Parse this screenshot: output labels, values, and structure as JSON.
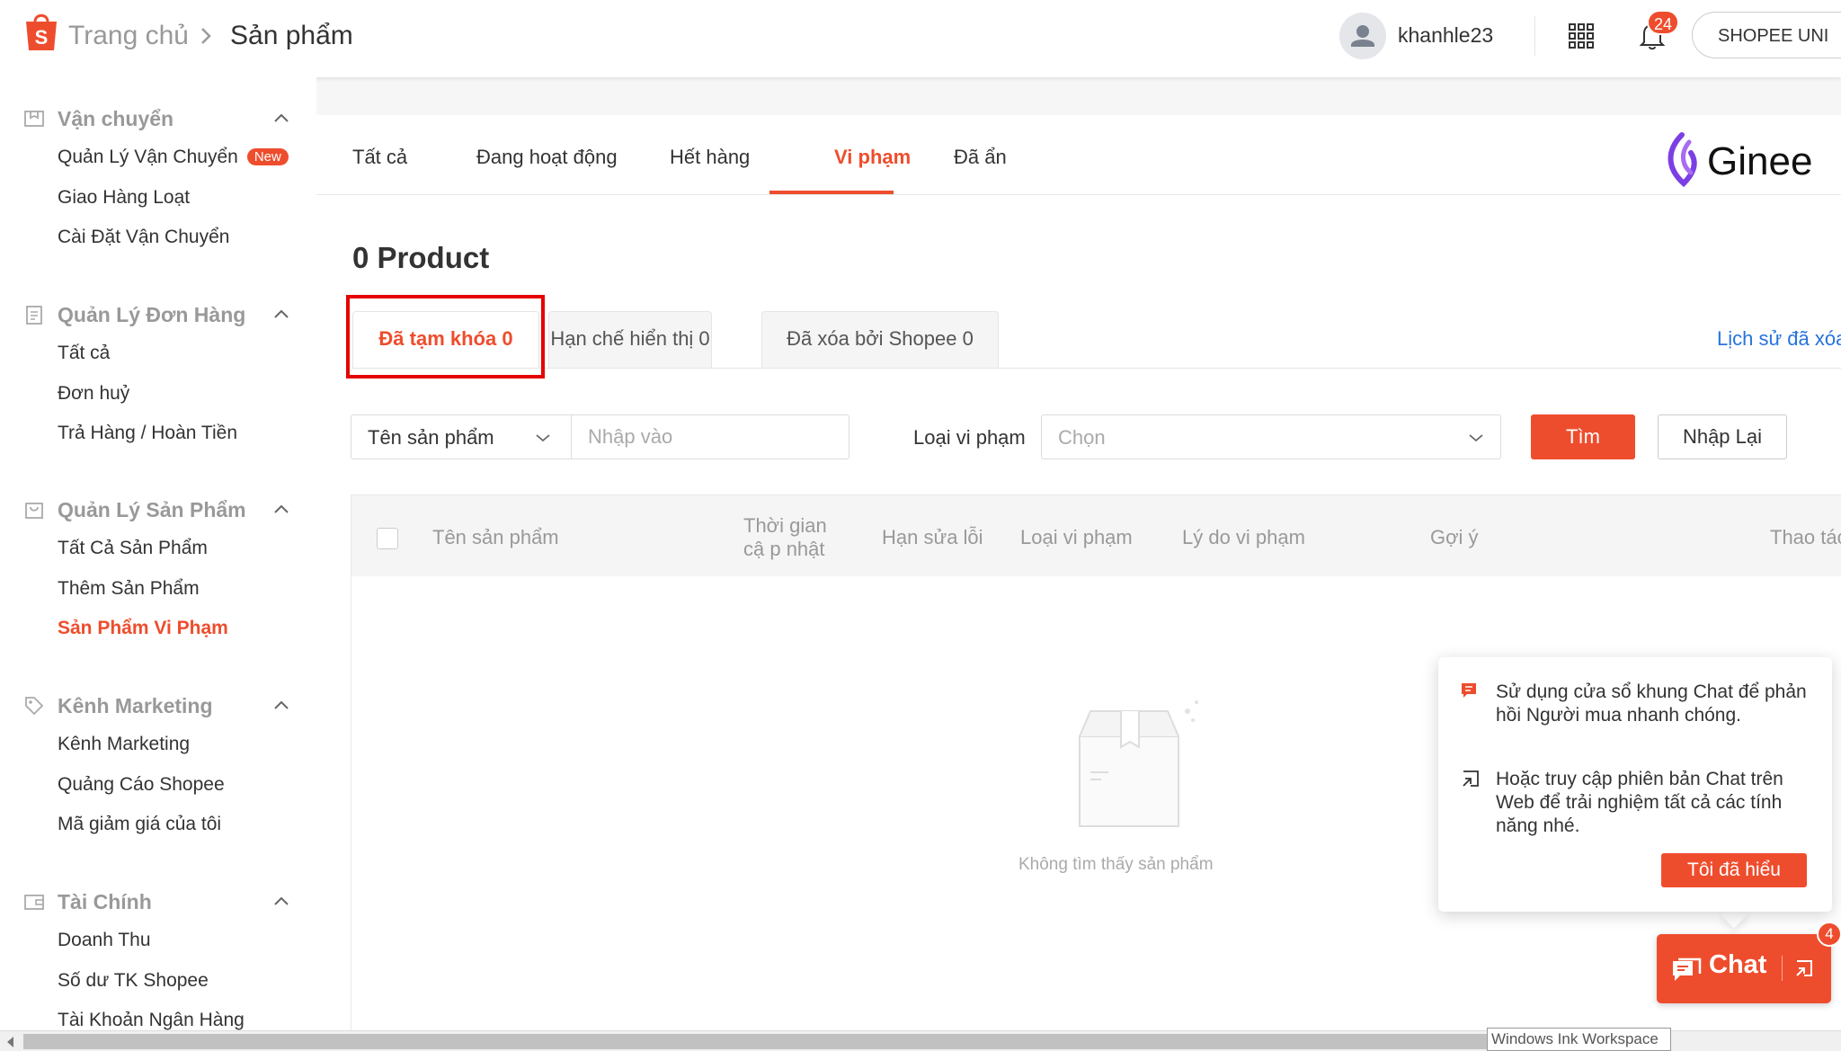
{
  "header": {
    "breadcrumb_home": "Trang chủ",
    "breadcrumb_current": "Sản phẩm",
    "username": "khanhle23",
    "notification_count": "24",
    "shop_button": "SHOPEE UNI"
  },
  "sidebar": {
    "sections": [
      {
        "title": "Vận chuyển",
        "icon": "shipping-box-icon",
        "items": [
          "Quản Lý Vận Chuyển",
          "Giao Hàng Loạt",
          "Cài Đặt Vận Chuyển"
        ],
        "new_badge": "New"
      },
      {
        "title": "Quản Lý Đơn Hàng",
        "icon": "clipboard-icon",
        "items": [
          "Tất cả",
          "Đơn huỷ",
          "Trả Hàng / Hoàn Tiền"
        ]
      },
      {
        "title": "Quản Lý Sản Phẩm",
        "icon": "bag-icon",
        "items": [
          "Tất Cả Sản Phẩm",
          "Thêm Sản Phẩm",
          "Sản Phẩm Vi Phạm"
        ]
      },
      {
        "title": "Kênh Marketing",
        "icon": "tag-icon",
        "items": [
          "Kênh Marketing",
          "Quảng Cáo Shopee",
          "Mã giảm giá của tôi"
        ]
      },
      {
        "title": "Tài Chính",
        "icon": "wallet-icon",
        "items": [
          "Doanh Thu",
          "Số dư TK Shopee",
          "Tài Khoản Ngân Hàng"
        ]
      }
    ]
  },
  "tabs": [
    "Tất cả",
    "Đang hoạt động",
    "Hết hàng",
    "Vi phạm",
    "Đã ẩn"
  ],
  "ginee_logo": "Ginee",
  "product_count_title": "0 Product",
  "subtabs": [
    "Đã tạm khóa 0",
    "Hạn chế hiển thị 0",
    "Đã xóa bởi Shopee 0"
  ],
  "history_link": "Lịch sử đã xóa",
  "filters": {
    "field_select": "Tên sản phẩm",
    "input_placeholder": "Nhập vào",
    "violation_label": "Loại vi phạm",
    "violation_placeholder": "Chọn",
    "search_button": "Tìm",
    "reset_button": "Nhập Lại"
  },
  "table": {
    "headers": [
      "Tên sản phẩm",
      "Thời gian cậ p nhật",
      "Hạn sửa lỗi",
      "Loại vi phạm",
      "Lý do vi phạm",
      "Gợi ý",
      "Thao tác"
    ],
    "empty_text": "Không tìm thấy sản phẩm"
  },
  "chat_popover": {
    "line1": "Sử dụng cửa sổ khung Chat để phản hồi Người mua nhanh chóng.",
    "line2": "Hoặc truy cập phiên bản Chat trên Web để trải nghiệm tất cả các tính năng nhé.",
    "button": "Tôi đã hiểu"
  },
  "chat_button": {
    "label": "Chat",
    "badge": "4"
  },
  "taskbar_tooltip": "Windows Ink Workspace",
  "colors": {
    "brand": "#ee4d2d",
    "link": "#2673dd",
    "highlight_box": "#e60000",
    "ginee_purple": "#7b3fe4"
  }
}
